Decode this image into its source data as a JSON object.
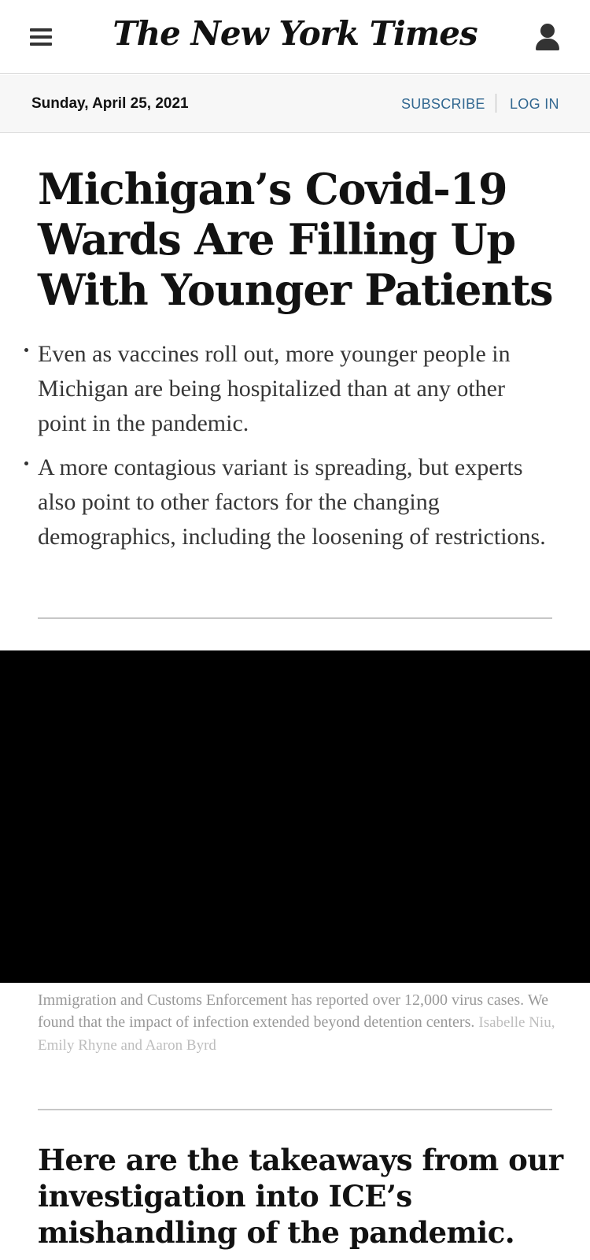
{
  "header": {
    "logo": "The New York Times",
    "menu_icon": "hamburger-menu-icon",
    "account_icon": "user-account-icon"
  },
  "datebar": {
    "date": "Sunday, April 25, 2021",
    "subscribe_label": "SUBSCRIBE",
    "login_label": "LOG IN"
  },
  "article": {
    "headline": "Michigan’s Covid-19 Wards Are Filling Up With Younger Patients",
    "summary": [
      "Even as vaccines roll out, more younger people in Michigan are being hospitalized than at any other point in the pandemic.",
      "A more contagious variant is spreading, but experts also point to other factors for the changing demographics, including the loosening of restrictions."
    ]
  },
  "video": {
    "caption": "Immigration and Customs Enforcement has reported over 12,000 virus cases. We found that the impact of infection extended beyond detention centers.",
    "credit": "Isabelle Niu, Emily Rhyne and Aaron Byrd"
  },
  "next_story": {
    "headline": "Here are the takeaways from our investigation into ICE’s mishandling of the pandemic."
  },
  "colors": {
    "link_blue": "#326891",
    "text_dark": "#121212",
    "caption_gray": "#999999"
  }
}
